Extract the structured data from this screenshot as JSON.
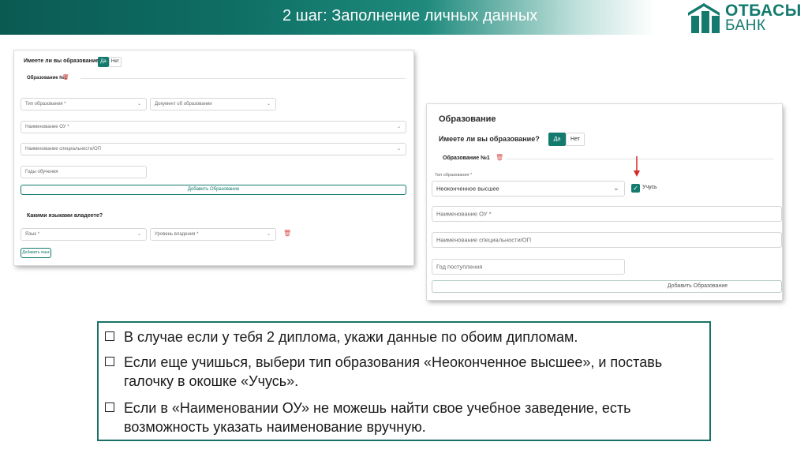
{
  "header": {
    "title": "2 шаг: Заполнение личных данных",
    "logo_line1": "ОТБАСЫ",
    "logo_line2": "БАНК",
    "accent_color": "#147a6e"
  },
  "left_form": {
    "education_question": "Имеете ли вы образование?",
    "yes_label": "Да",
    "no_label": "Нет",
    "section_label": "Образование №1",
    "education_type": "Тип образования *",
    "education_document": "Документ об образовании",
    "institution_name": "Наименование ОУ *",
    "specialty_name": "Наименование специальности/ОП",
    "study_years": "Годы обучения",
    "add_education": "Добавить Образование",
    "languages_question": "Какими языками владеете?",
    "language": "Язык *",
    "proficiency_level": "Уровень владения *",
    "add_language": "Добавить язык"
  },
  "right_form": {
    "title": "Образование",
    "education_question": "Имеете ли вы образование?",
    "yes_label": "Да",
    "no_label": "Нет",
    "section_label": "Образование №1",
    "education_type_caption": "Тип образования *",
    "education_type_value": "Неоконченное высшее",
    "studying_label": "Учусь",
    "studying_checked": true,
    "institution_name": "Наименование ОУ *",
    "specialty_name": "Наименование специальности/ОП",
    "admission_year": "Год поступления",
    "add_education": "Добавить Образование"
  },
  "info": {
    "bullets": [
      "В случае если у тебя 2 диплома, укажи данные по обоим дипломам.",
      "Если еще учишься, выбери тип образования «Неоконченное высшее», и поставь галочку в окошке «Учусь».",
      "Если в «Наименовании ОУ» не можешь найти свое учебное заведение, есть возможность указать наименование вручную."
    ]
  }
}
